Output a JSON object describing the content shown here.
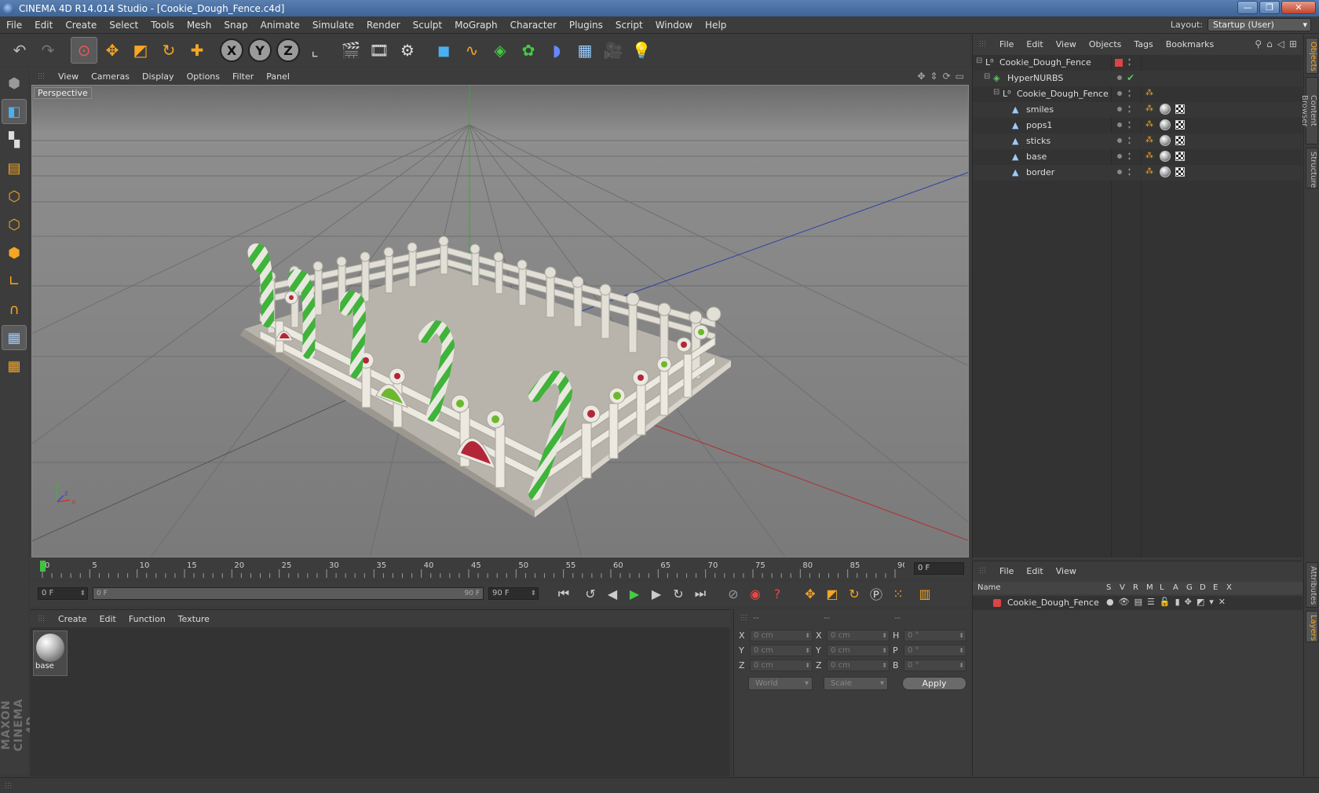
{
  "window": {
    "title": "CINEMA 4D R14.014 Studio - [Cookie_Dough_Fence.c4d]"
  },
  "menubar": {
    "items": [
      "File",
      "Edit",
      "Create",
      "Select",
      "Tools",
      "Mesh",
      "Snap",
      "Animate",
      "Simulate",
      "Render",
      "Sculpt",
      "MoGraph",
      "Character",
      "Plugins",
      "Script",
      "Window",
      "Help"
    ],
    "layout_label": "Layout:",
    "layout_value": "Startup (User)"
  },
  "toolbar": {
    "axis_x": "X",
    "axis_y": "Y",
    "axis_z": "Z"
  },
  "leftbar": {
    "logo": "MAXON CINEMA 4D"
  },
  "viewport": {
    "menu": [
      "View",
      "Cameras",
      "Display",
      "Options",
      "Filter",
      "Panel"
    ],
    "label": "Perspective",
    "axis_y": "y",
    "axis_z": "z",
    "axis_x": "x"
  },
  "timeline": {
    "ticks": [
      "0",
      "5",
      "10",
      "15",
      "20",
      "25",
      "30",
      "35",
      "40",
      "45",
      "50",
      "55",
      "60",
      "65",
      "70",
      "75",
      "80",
      "85",
      "90"
    ],
    "current_frame": "0 F",
    "max_frame": 90
  },
  "transport": {
    "start_field": "0 F",
    "range_start": "0 F",
    "range_end": "90 F",
    "end_field": "90 F"
  },
  "materials": {
    "menu": [
      "Create",
      "Edit",
      "Function",
      "Texture"
    ],
    "items": [
      {
        "name": "base"
      }
    ]
  },
  "coords": {
    "header": [
      "--",
      "--",
      "--"
    ],
    "rows": [
      {
        "pos_label": "X",
        "pos": "0 cm",
        "size_label": "X",
        "size": "0 cm",
        "rot_label": "H",
        "rot": "0 °"
      },
      {
        "pos_label": "Y",
        "pos": "0 cm",
        "size_label": "Y",
        "size": "0 cm",
        "rot_label": "P",
        "rot": "0 °"
      },
      {
        "pos_label": "Z",
        "pos": "0 cm",
        "size_label": "Z",
        "size": "0 cm",
        "rot_label": "B",
        "rot": "0 °"
      }
    ],
    "mode": "World",
    "size_mode": "Scale",
    "apply": "Apply"
  },
  "objects": {
    "menu": [
      "File",
      "Edit",
      "View",
      "Objects",
      "Tags",
      "Bookmarks"
    ],
    "tree": [
      {
        "name": "Cookie_Dough_Fence",
        "depth": 0,
        "icon": "null"
      },
      {
        "name": "HyperNURBS",
        "depth": 1,
        "icon": "hypernurbs"
      },
      {
        "name": "Cookie_Dough_Fence",
        "depth": 2,
        "icon": "null"
      },
      {
        "name": "smiles",
        "depth": 3,
        "icon": "polygon"
      },
      {
        "name": "pops1",
        "depth": 3,
        "icon": "polygon"
      },
      {
        "name": "sticks",
        "depth": 3,
        "icon": "polygon"
      },
      {
        "name": "base",
        "depth": 3,
        "icon": "polygon"
      },
      {
        "name": "border",
        "depth": 3,
        "icon": "polygon"
      }
    ]
  },
  "layers": {
    "menu": [
      "File",
      "Edit",
      "View"
    ],
    "columns": [
      "Name",
      "S",
      "V",
      "R",
      "M",
      "L",
      "A",
      "G",
      "D",
      "E",
      "X"
    ],
    "rows": [
      {
        "name": "Cookie_Dough_Fence",
        "color": "#d44444"
      }
    ]
  },
  "right_tabs": [
    "Objects",
    "Content Browser",
    "Structure",
    "Attributes",
    "Layers"
  ]
}
